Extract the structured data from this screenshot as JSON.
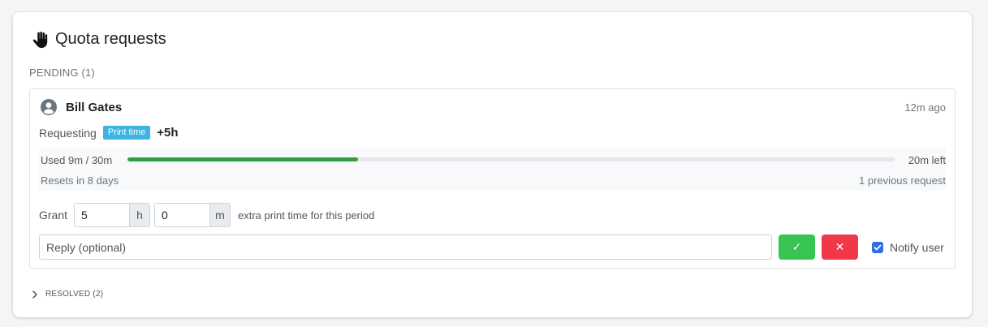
{
  "panel": {
    "title": "Quota requests",
    "title_icon": "hand-icon"
  },
  "pending": {
    "label": "PENDING (1)",
    "requests": [
      {
        "user_name": "Bill Gates",
        "avatar_icon": "user-circle-icon",
        "time_ago": "12m ago",
        "requesting_label": "Requesting",
        "quota_type": "Print time",
        "amount": "+5h",
        "used_text": "Used 9m / 30m",
        "used_fraction": 0.3,
        "left_text": "20m left",
        "resets_text": "Resets in 8 days",
        "previous_text": "1 previous request",
        "grant_label": "Grant",
        "grant_hours": "5",
        "hours_unit": "h",
        "grant_minutes": "0",
        "minutes_unit": "m",
        "grant_suffix": "extra print time for this period",
        "reply_placeholder": "Reply (optional)",
        "approve_icon": "check-icon",
        "approve_symbol": "✓",
        "deny_icon": "x-icon",
        "deny_symbol": "✕",
        "notify_label": "Notify user",
        "notify_checked": true
      }
    ]
  },
  "resolved": {
    "label": "RESOLVED (2)"
  },
  "colors": {
    "badge": "#3db4e1",
    "progress": "#2f9e44",
    "approve": "#37c452",
    "deny": "#f03849",
    "checkbox": "#2f6fe0"
  }
}
